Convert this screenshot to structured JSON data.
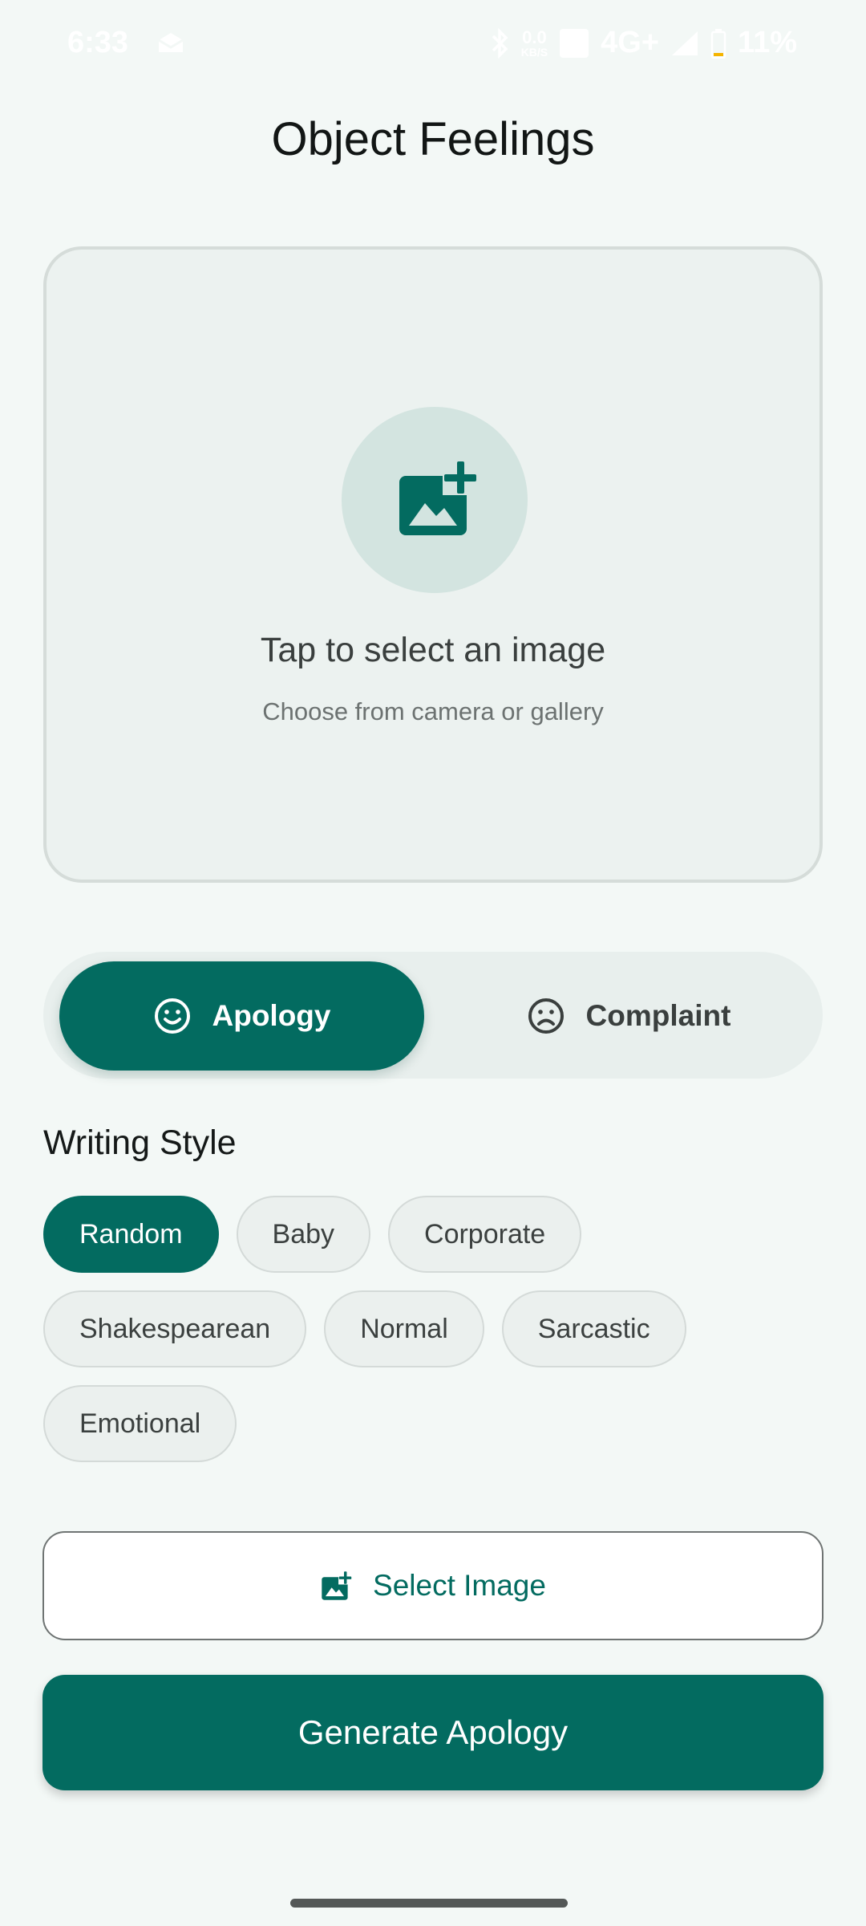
{
  "status_bar": {
    "time": "6:33",
    "network_speed_top": "0.0",
    "network_speed_bottom": "KB/S",
    "network_type": "4G+",
    "battery": "11%"
  },
  "app": {
    "title": "Object Feelings"
  },
  "image_picker": {
    "title": "Tap to select an image",
    "subtitle": "Choose from camera or gallery"
  },
  "mode_toggle": {
    "options": [
      {
        "label": "Apology",
        "icon": "smile-icon",
        "selected": true
      },
      {
        "label": "Complaint",
        "icon": "frown-icon",
        "selected": false
      }
    ]
  },
  "writing_style": {
    "label": "Writing Style",
    "chips": [
      {
        "label": "Random",
        "selected": true
      },
      {
        "label": "Baby",
        "selected": false
      },
      {
        "label": "Corporate",
        "selected": false
      },
      {
        "label": "Shakespearean",
        "selected": false
      },
      {
        "label": "Normal",
        "selected": false
      },
      {
        "label": "Sarcastic",
        "selected": false
      },
      {
        "label": "Emotional",
        "selected": false
      }
    ]
  },
  "actions": {
    "select_image_label": "Select Image",
    "generate_label": "Generate Apology"
  },
  "colors": {
    "primary": "#036b60",
    "background": "#f3f8f6",
    "surface": "#ecf2f0"
  }
}
